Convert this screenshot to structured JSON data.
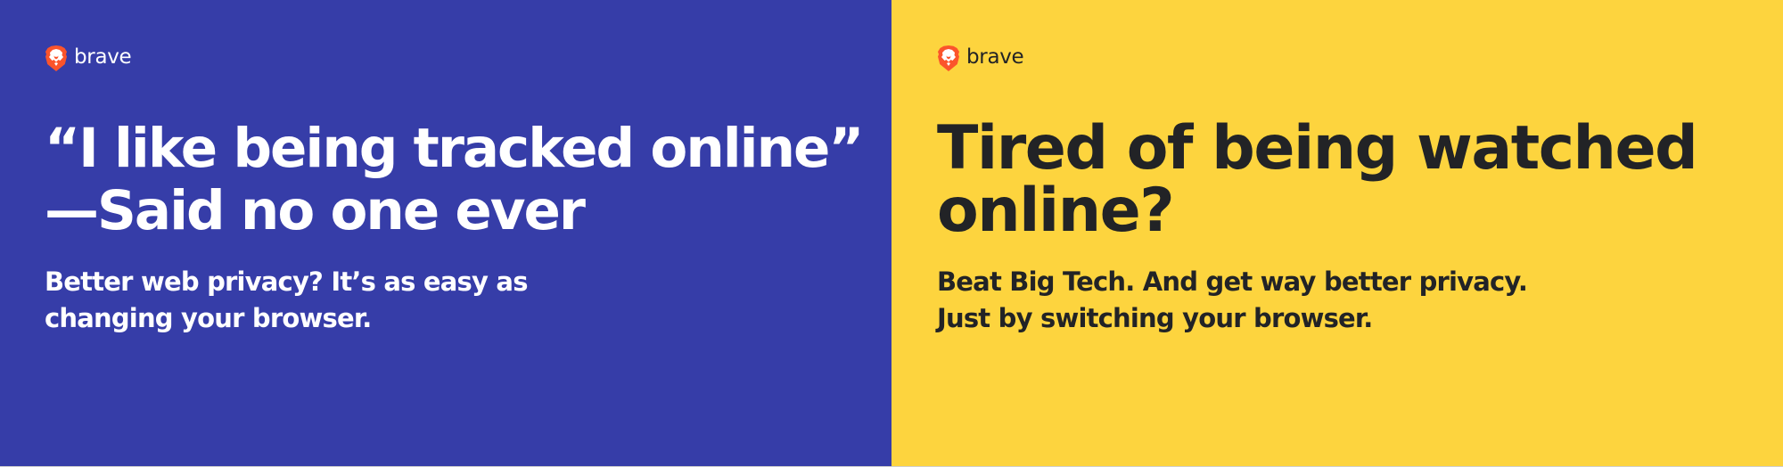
{
  "left_ad": {
    "background": "#363DA8",
    "text_color": "#FFFFFF",
    "logo": {
      "icon": "brave-lion-icon",
      "wordmark": "brave"
    },
    "headline_lines": [
      "“I like being tracked online”",
      "—Said no one ever"
    ],
    "subhead_lines": [
      "Better web privacy? It’s as easy as",
      "changing your browser."
    ]
  },
  "right_ad": {
    "background": "#FDD43E",
    "text_color": "#222326",
    "logo": {
      "icon": "brave-lion-icon",
      "wordmark": "brave"
    },
    "headline_lines": [
      "Tired of being watched",
      "online?"
    ],
    "subhead_lines": [
      "Beat Big Tech. And get way better privacy.",
      "Just by switching your browser."
    ]
  },
  "brand_colors": {
    "lion_orange": "#FB542B",
    "lion_red": "#EF3A2A"
  }
}
